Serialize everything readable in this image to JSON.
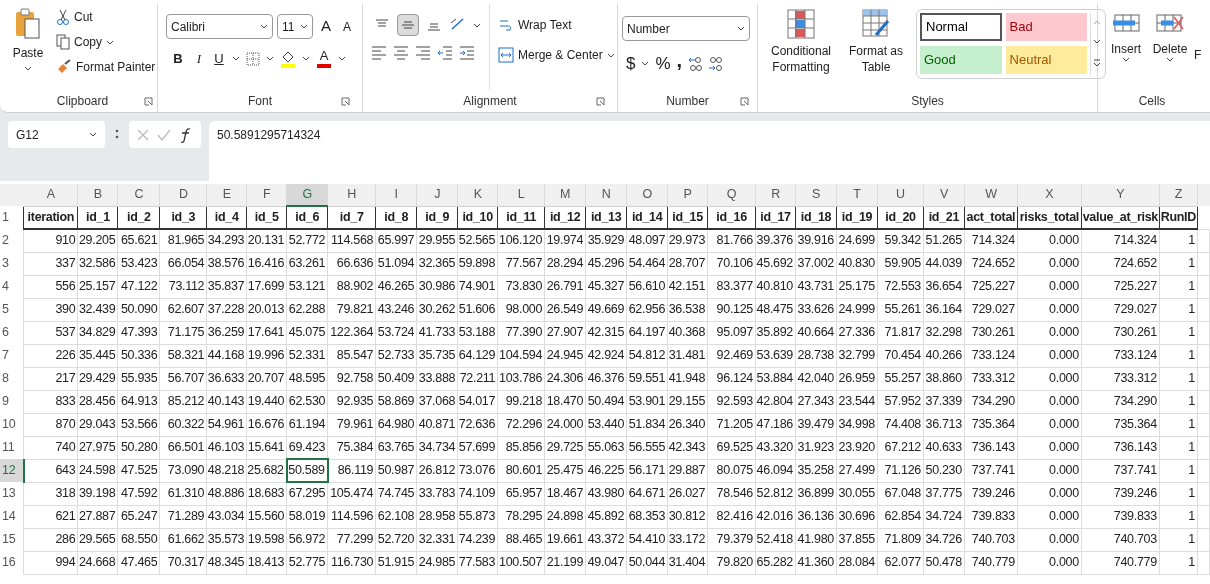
{
  "ribbon": {
    "clipboard": {
      "label": "Clipboard",
      "paste": "Paste",
      "cut": "Cut",
      "copy": "Copy",
      "format_painter": "Format Painter"
    },
    "font": {
      "label": "Font",
      "name": "Calibri",
      "size": "11",
      "grow": "A",
      "shrink": "A",
      "bold": "B",
      "italic": "I",
      "underline": "U",
      "font_color": "A"
    },
    "alignment": {
      "label": "Alignment",
      "vertical": [
        {
          "kind": "top",
          "selected": false
        },
        {
          "kind": "middle",
          "selected": true
        },
        {
          "kind": "bottom",
          "selected": false
        }
      ],
      "wrap_text": "Wrap Text",
      "merge_center": "Merge & Center"
    },
    "number": {
      "label": "Number",
      "format": "Number",
      "currency": "$",
      "percent": "%",
      "comma": ","
    },
    "styles": {
      "label": "Styles",
      "conditional_formatting": "Conditional Formatting",
      "format_as_table": "Format as Table",
      "cell_styles": [
        {
          "name": "Normal",
          "kind": "normal"
        },
        {
          "name": "Bad",
          "kind": "bad"
        },
        {
          "name": "Good",
          "kind": "good"
        },
        {
          "name": "Neutral",
          "kind": "neutral"
        }
      ]
    },
    "cells": {
      "label": "Cells",
      "insert": "Insert",
      "delete": "Delete",
      "format": "F"
    }
  },
  "formula_bar": {
    "name_box": "G12",
    "formula": "50.5891295714324"
  },
  "sheet": {
    "columns": [
      {
        "letter": "A",
        "selected": false
      },
      {
        "letter": "B",
        "selected": false
      },
      {
        "letter": "C",
        "selected": false
      },
      {
        "letter": "D",
        "selected": false
      },
      {
        "letter": "E",
        "selected": false
      },
      {
        "letter": "F",
        "selected": false
      },
      {
        "letter": "G",
        "selected": true
      },
      {
        "letter": "H",
        "selected": false
      },
      {
        "letter": "I",
        "selected": false
      },
      {
        "letter": "J",
        "selected": false
      },
      {
        "letter": "K",
        "selected": false
      },
      {
        "letter": "L",
        "selected": false
      },
      {
        "letter": "M",
        "selected": false
      },
      {
        "letter": "N",
        "selected": false
      },
      {
        "letter": "O",
        "selected": false
      },
      {
        "letter": "P",
        "selected": false
      },
      {
        "letter": "Q",
        "selected": false
      },
      {
        "letter": "R",
        "selected": false
      },
      {
        "letter": "S",
        "selected": false
      },
      {
        "letter": "T",
        "selected": false
      },
      {
        "letter": "U",
        "selected": false
      },
      {
        "letter": "V",
        "selected": false
      },
      {
        "letter": "W",
        "selected": false
      },
      {
        "letter": "X",
        "selected": false
      },
      {
        "letter": "Y",
        "selected": false
      },
      {
        "letter": "Z",
        "selected": false
      }
    ],
    "header_row": {
      "number": "1",
      "cells": [
        "iteration",
        "id_1",
        "id_2",
        "id_3",
        "id_4",
        "id_5",
        "id_6",
        "id_7",
        "id_8",
        "id_9",
        "id_10",
        "id_11",
        "id_12",
        "id_13",
        "id_14",
        "id_15",
        "id_16",
        "id_17",
        "id_18",
        "id_19",
        "id_20",
        "id_21",
        "act_total",
        "risks_total",
        "value_at_risk",
        "RunID"
      ]
    },
    "rows": [
      {
        "number": "2",
        "selected": false,
        "cells": [
          "910",
          "29.205",
          "65.621",
          "81.965",
          "34.293",
          "20.131",
          "52.772",
          "114.568",
          "65.997",
          "29.955",
          "52.565",
          "106.120",
          "19.974",
          "35.929",
          "48.097",
          "29.973",
          "81.766",
          "39.376",
          "39.916",
          "24.699",
          "59.342",
          "51.265",
          "714.324",
          "0.000",
          "714.324",
          "1"
        ]
      },
      {
        "number": "3",
        "selected": false,
        "cells": [
          "337",
          "32.586",
          "53.423",
          "66.054",
          "38.576",
          "16.416",
          "63.261",
          "66.636",
          "51.094",
          "32.365",
          "59.898",
          "77.567",
          "28.294",
          "45.296",
          "54.464",
          "28.707",
          "70.106",
          "45.692",
          "37.002",
          "40.830",
          "59.905",
          "44.039",
          "724.652",
          "0.000",
          "724.652",
          "1"
        ]
      },
      {
        "number": "4",
        "selected": false,
        "cells": [
          "556",
          "25.157",
          "47.122",
          "73.112",
          "35.837",
          "17.699",
          "53.121",
          "88.902",
          "46.265",
          "30.986",
          "74.901",
          "73.830",
          "26.791",
          "45.327",
          "56.610",
          "42.151",
          "83.377",
          "40.810",
          "43.731",
          "25.175",
          "72.553",
          "36.654",
          "725.227",
          "0.000",
          "725.227",
          "1"
        ]
      },
      {
        "number": "5",
        "selected": false,
        "cells": [
          "390",
          "32.439",
          "50.090",
          "62.607",
          "37.228",
          "20.013",
          "62.288",
          "79.821",
          "43.246",
          "30.262",
          "51.606",
          "98.000",
          "26.549",
          "49.669",
          "62.956",
          "36.538",
          "90.125",
          "48.475",
          "33.626",
          "24.999",
          "55.261",
          "36.164",
          "729.027",
          "0.000",
          "729.027",
          "1"
        ]
      },
      {
        "number": "6",
        "selected": false,
        "cells": [
          "537",
          "34.829",
          "47.393",
          "71.175",
          "36.259",
          "17.641",
          "45.075",
          "122.364",
          "53.724",
          "41.733",
          "53.188",
          "77.390",
          "27.907",
          "42.315",
          "64.197",
          "40.368",
          "95.097",
          "35.892",
          "40.664",
          "27.336",
          "71.817",
          "32.298",
          "730.261",
          "0.000",
          "730.261",
          "1"
        ]
      },
      {
        "number": "7",
        "selected": false,
        "cells": [
          "226",
          "35.445",
          "50.336",
          "58.321",
          "44.168",
          "19.996",
          "52.331",
          "85.547",
          "52.733",
          "35.735",
          "64.129",
          "104.594",
          "24.945",
          "42.924",
          "54.812",
          "31.481",
          "92.469",
          "53.639",
          "28.738",
          "32.799",
          "70.454",
          "40.266",
          "733.124",
          "0.000",
          "733.124",
          "1"
        ]
      },
      {
        "number": "8",
        "selected": false,
        "cells": [
          "217",
          "29.429",
          "55.935",
          "56.707",
          "36.633",
          "20.707",
          "48.595",
          "92.758",
          "50.409",
          "33.888",
          "72.211",
          "103.786",
          "24.306",
          "46.376",
          "59.551",
          "41.948",
          "96.124",
          "53.884",
          "42.040",
          "26.959",
          "55.257",
          "38.860",
          "733.312",
          "0.000",
          "733.312",
          "1"
        ]
      },
      {
        "number": "9",
        "selected": false,
        "cells": [
          "833",
          "28.456",
          "64.913",
          "85.212",
          "40.143",
          "19.440",
          "62.530",
          "92.935",
          "58.869",
          "37.068",
          "54.017",
          "99.218",
          "18.470",
          "50.494",
          "53.901",
          "29.155",
          "92.593",
          "42.804",
          "27.343",
          "23.544",
          "57.952",
          "37.339",
          "734.290",
          "0.000",
          "734.290",
          "1"
        ]
      },
      {
        "number": "10",
        "selected": false,
        "cells": [
          "870",
          "29.043",
          "53.566",
          "60.322",
          "54.961",
          "16.676",
          "61.194",
          "79.961",
          "64.980",
          "40.871",
          "72.636",
          "72.296",
          "24.000",
          "53.440",
          "51.834",
          "26.340",
          "71.205",
          "47.186",
          "39.479",
          "34.998",
          "74.408",
          "36.713",
          "735.364",
          "0.000",
          "735.364",
          "1"
        ]
      },
      {
        "number": "11",
        "selected": false,
        "cells": [
          "740",
          "27.975",
          "50.280",
          "66.501",
          "46.103",
          "15.641",
          "69.423",
          "75.384",
          "63.765",
          "34.734",
          "57.699",
          "85.856",
          "29.725",
          "55.063",
          "56.555",
          "42.343",
          "69.525",
          "43.320",
          "31.923",
          "23.920",
          "67.212",
          "40.633",
          "736.143",
          "0.000",
          "736.143",
          "1"
        ]
      },
      {
        "number": "12",
        "selected": true,
        "cells": [
          "643",
          "24.598",
          "47.525",
          "73.090",
          "48.218",
          "25.682",
          "50.589",
          "86.119",
          "50.987",
          "26.812",
          "73.076",
          "80.601",
          "25.475",
          "46.225",
          "56.171",
          "29.887",
          "80.075",
          "46.094",
          "35.258",
          "27.499",
          "71.126",
          "50.230",
          "737.741",
          "0.000",
          "737.741",
          "1"
        ]
      },
      {
        "number": "13",
        "selected": false,
        "cells": [
          "318",
          "39.198",
          "47.592",
          "61.310",
          "48.886",
          "18.683",
          "67.295",
          "105.474",
          "74.745",
          "33.783",
          "74.109",
          "65.957",
          "18.467",
          "43.980",
          "64.671",
          "26.027",
          "78.546",
          "52.812",
          "36.899",
          "30.055",
          "67.048",
          "37.775",
          "739.246",
          "0.000",
          "739.246",
          "1"
        ]
      },
      {
        "number": "14",
        "selected": false,
        "cells": [
          "621",
          "27.887",
          "65.247",
          "71.289",
          "43.034",
          "15.560",
          "58.019",
          "114.596",
          "62.108",
          "28.958",
          "55.873",
          "78.295",
          "24.898",
          "45.892",
          "68.353",
          "30.812",
          "82.416",
          "42.016",
          "36.136",
          "30.696",
          "62.854",
          "34.724",
          "739.833",
          "0.000",
          "739.833",
          "1"
        ]
      },
      {
        "number": "15",
        "selected": false,
        "cells": [
          "286",
          "29.565",
          "68.550",
          "61.662",
          "35.573",
          "19.598",
          "56.972",
          "77.299",
          "52.720",
          "32.331",
          "74.239",
          "88.465",
          "19.661",
          "43.372",
          "54.410",
          "33.172",
          "79.379",
          "52.418",
          "41.980",
          "37.855",
          "71.809",
          "34.726",
          "740.703",
          "0.000",
          "740.703",
          "1"
        ]
      },
      {
        "number": "16",
        "selected": false,
        "cells": [
          "994",
          "24.668",
          "47.465",
          "70.317",
          "48.345",
          "18.413",
          "52.775",
          "116.730",
          "51.915",
          "24.985",
          "77.583",
          "100.507",
          "21.199",
          "49.047",
          "50.044",
          "31.404",
          "79.820",
          "65.282",
          "41.360",
          "28.084",
          "62.077",
          "50.478",
          "740.779",
          "0.000",
          "740.779",
          "1"
        ]
      }
    ]
  }
}
